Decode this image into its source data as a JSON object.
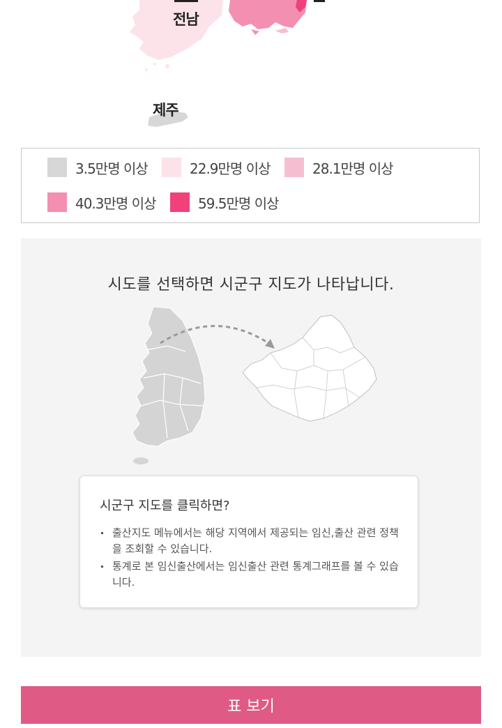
{
  "map": {
    "labels": {
      "jeonnam": "전남",
      "jeju": "제주"
    },
    "colors": {
      "light_gray": "#d7d7d7",
      "pale_pink": "#fbe3e9",
      "light_pink": "#f6bfd1",
      "medium_pink": "#f38fb0",
      "hot_pink": "#f0417a"
    }
  },
  "legend": {
    "items": [
      {
        "label": "3.5만명 이상",
        "color": "#d7d7d7"
      },
      {
        "label": "22.9만명 이상",
        "color": "#fbe3e9"
      },
      {
        "label": "28.1만명 이상",
        "color": "#f6bfd1"
      },
      {
        "label": "40.3만명 이상",
        "color": "#f38fb0"
      },
      {
        "label": "59.5만명 이상",
        "color": "#f0417a"
      }
    ]
  },
  "info_panel": {
    "heading": "시도를 선택하면 시군구 지도가 나타납니다.",
    "tip": {
      "title": "시군구 지도를 클릭하면?",
      "items": [
        "출산지도 메뉴에서는 해당 지역에서 제공되는 임신,출산 관련 정책을 조회할 수 있습니다.",
        "통계로 본 임신출산에서는 임신출산 관련 통계그래프를 볼 수 있습니다."
      ]
    }
  },
  "actions": {
    "table_view_label": "표 보기"
  }
}
